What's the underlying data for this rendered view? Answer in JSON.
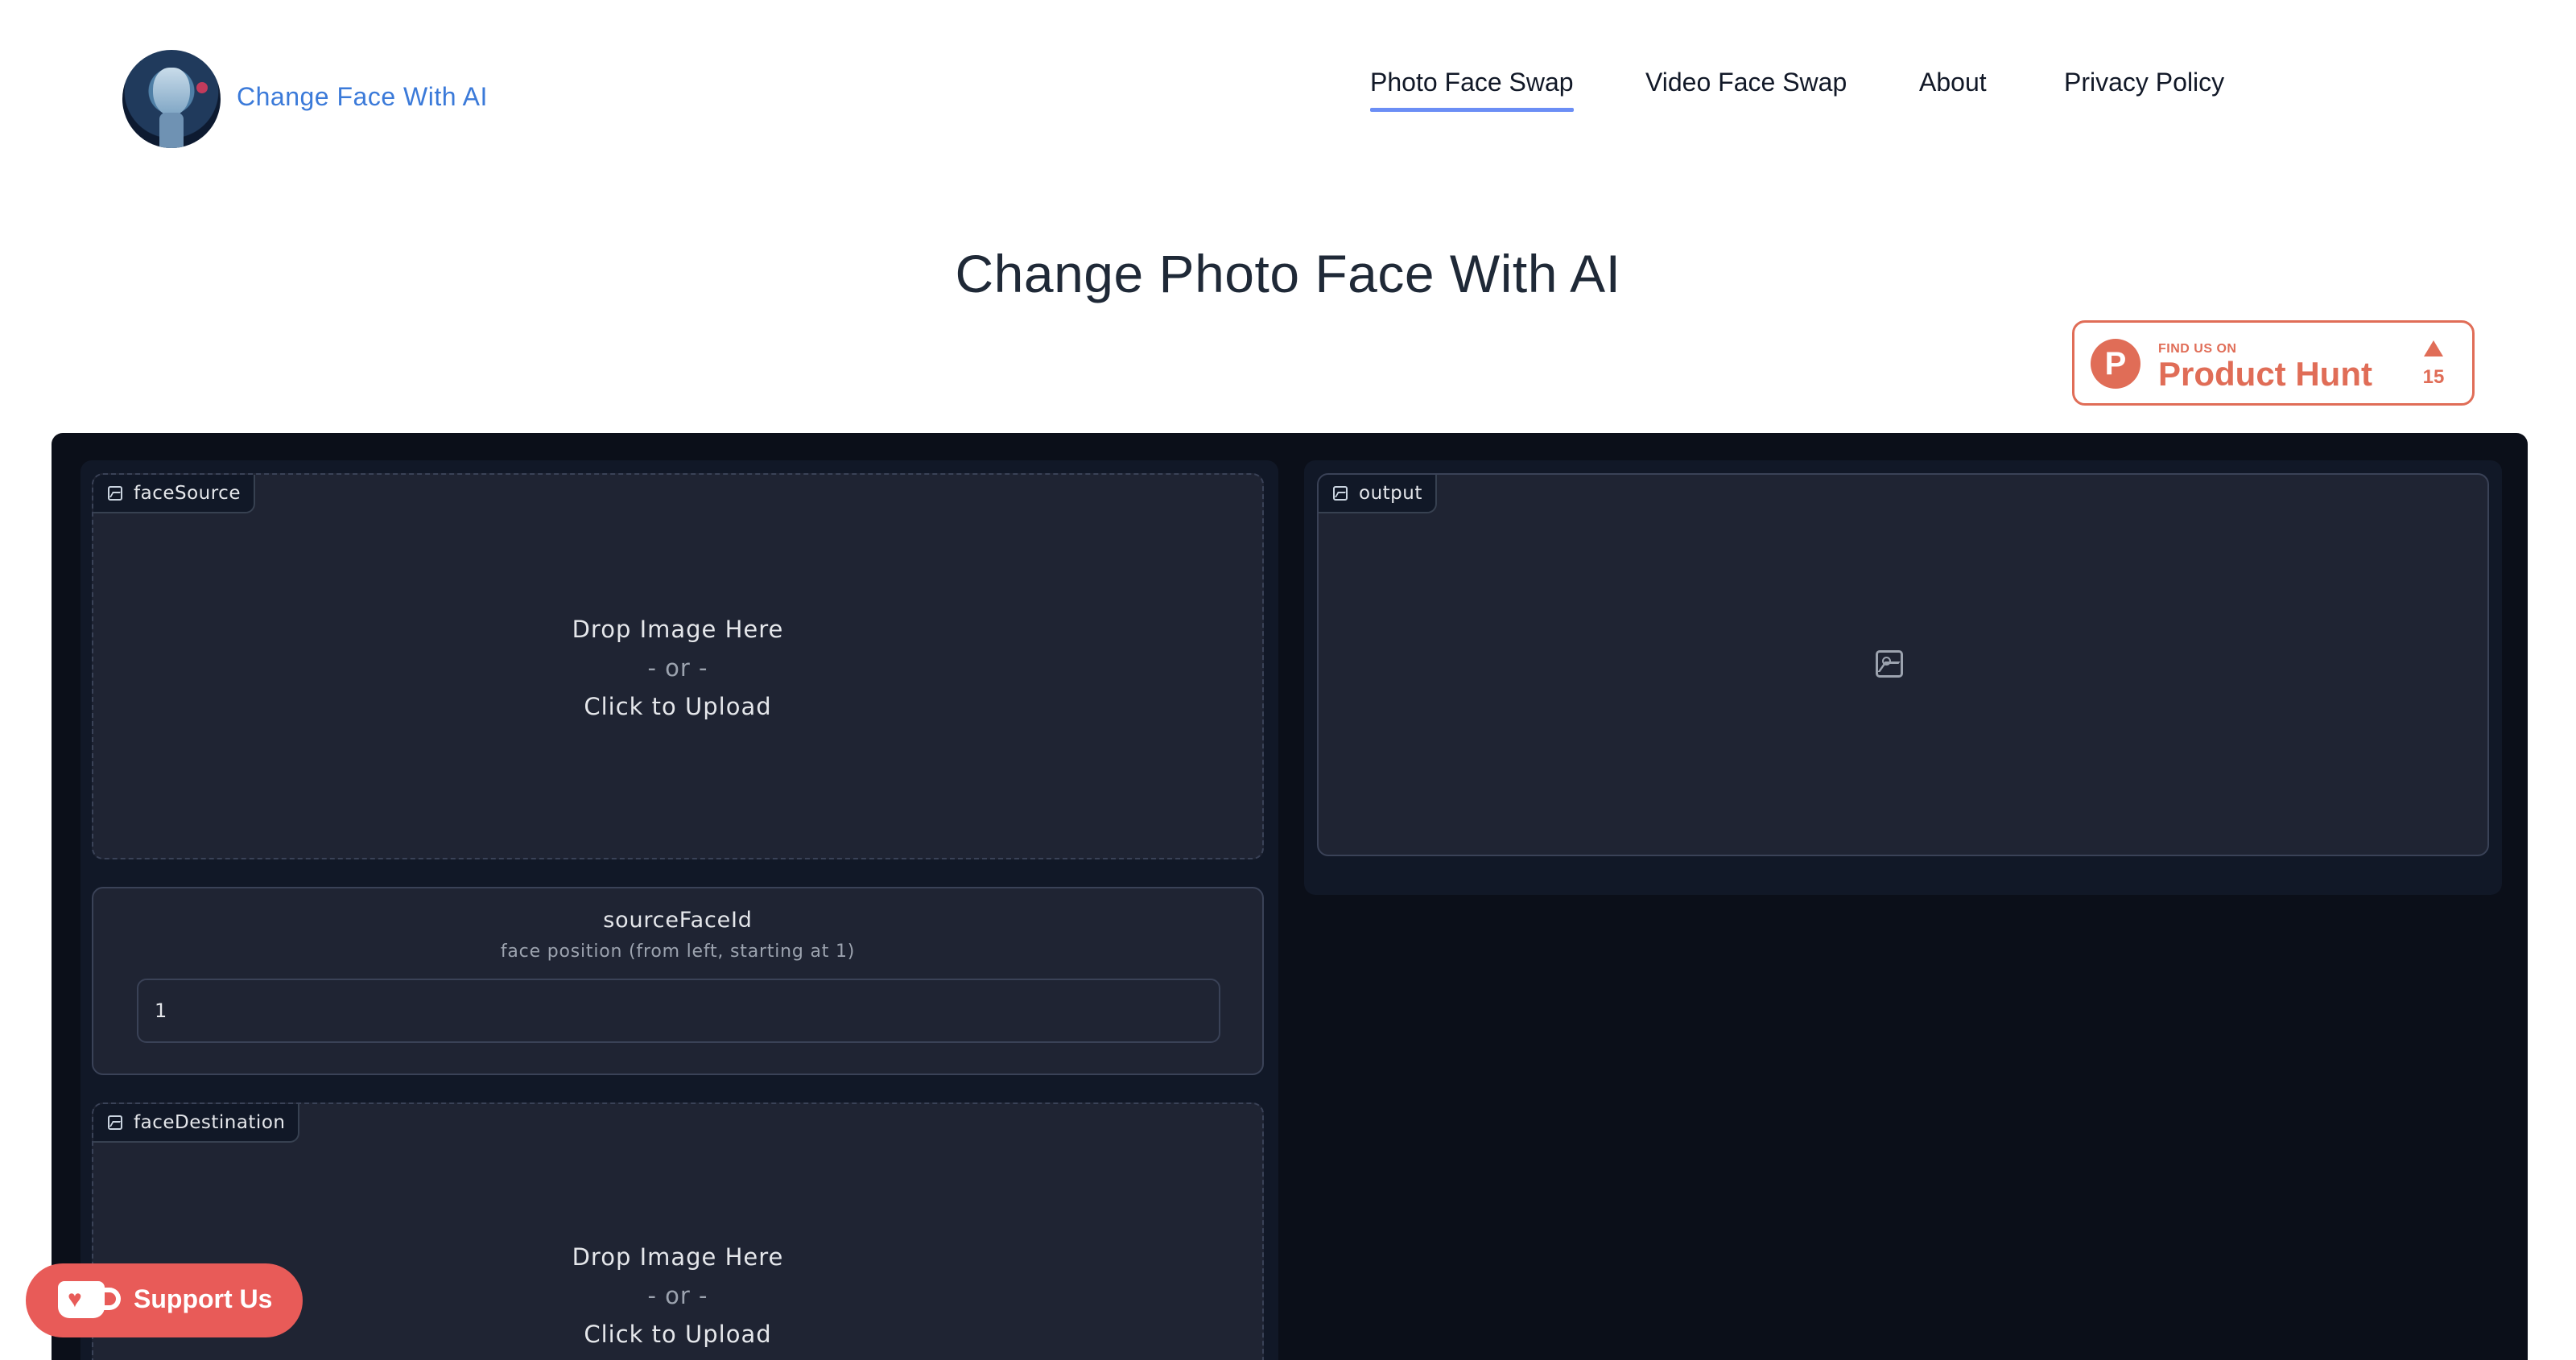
{
  "header": {
    "logo_text": "Change Face With AI",
    "nav": [
      {
        "label": "Photo Face Swap",
        "active": true
      },
      {
        "label": "Video Face Swap",
        "active": false
      },
      {
        "label": "About",
        "active": false
      },
      {
        "label": "Privacy Policy",
        "active": false
      }
    ]
  },
  "page": {
    "title": "Change Photo Face With AI"
  },
  "product_hunt": {
    "small_text": "FIND US ON",
    "big_text": "Product Hunt",
    "letter": "P",
    "count": "15"
  },
  "face_source": {
    "label": "faceSource",
    "drop_line1": "Drop Image Here",
    "drop_line2": "- or -",
    "drop_line3": "Click to Upload"
  },
  "source_face_id": {
    "label": "sourceFaceId",
    "info": "face position (from left, starting at 1)",
    "value": "1"
  },
  "face_destination": {
    "label": "faceDestination",
    "drop_line1": "Drop Image Here",
    "drop_line2": "- or -",
    "drop_line3": "Click to Upload"
  },
  "output": {
    "label": "output"
  },
  "support": {
    "label": "Support Us"
  },
  "colors": {
    "accent": "#3b7ad9",
    "nav_underline": "#6b8ef5",
    "product_hunt": "#e06d57",
    "support_button": "#e85b58",
    "app_background": "#0b0f19",
    "panel": "#1f2433"
  }
}
